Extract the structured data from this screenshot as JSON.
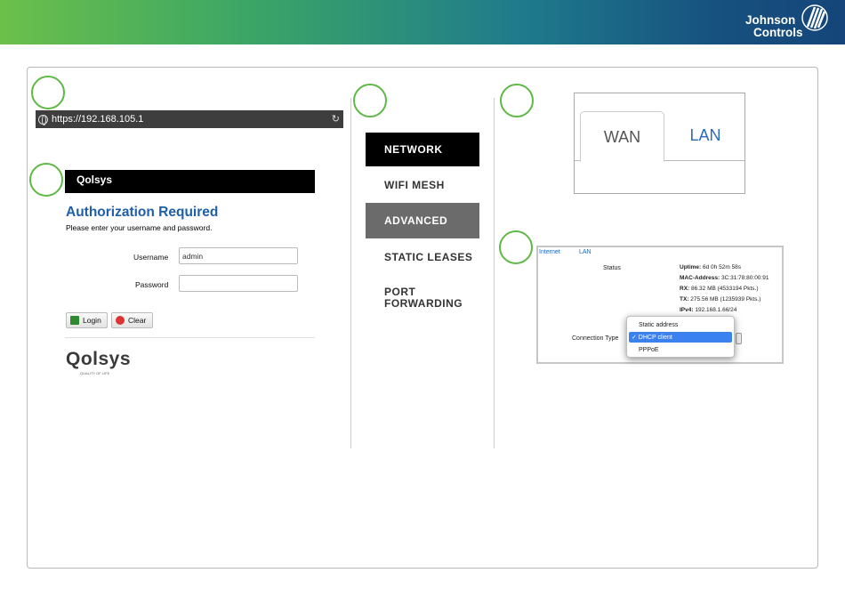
{
  "brand": {
    "line1": "Johnson",
    "line2": "Controls"
  },
  "browser": {
    "url": "https://192.168.105.1"
  },
  "login": {
    "header_logo": "Qolsys",
    "title": "Authorization Required",
    "subtitle": "Please enter your username and password.",
    "username_label": "Username",
    "username_value": "admin",
    "password_label": "Password",
    "login_label": "Login",
    "clear_label": "Clear",
    "footer_logo": "Qolsys",
    "footer_tagline": "QUALITY OF LIFE"
  },
  "menu": {
    "items": [
      {
        "label": "NETWORK",
        "style": "dark"
      },
      {
        "label": "WIFI MESH",
        "style": "plain"
      },
      {
        "label": "ADVANCED",
        "style": "grey"
      },
      {
        "label": "STATIC LEASES",
        "style": "plain"
      },
      {
        "label": "PORT FORWARDING",
        "style": "plain"
      }
    ]
  },
  "tabs": {
    "wan": "WAN",
    "lan": "LAN"
  },
  "network": {
    "tab_internet": "Internet",
    "tab_lan": "LAN",
    "status_label": "Status",
    "uptime_key": "Uptime:",
    "uptime": "6d 0h 52m 58s",
    "mac_key": "MAC-Address:",
    "mac": "3C:31:78:80:00:91",
    "rx_key": "RX:",
    "rx": "86.32 MB (4533194 Pkts.)",
    "tx_key": "TX:",
    "tx": "275.56 MB (1235939 Pkts.)",
    "ipv4_key": "IPv4:",
    "ipv4": "192.168.1.66/24",
    "connection_type_label": "Connection Type",
    "options": [
      "Static address",
      "✓ DHCP client",
      "PPPoE"
    ],
    "selected": "✓ DHCP client"
  },
  "colors": {
    "accent_green": "#5fb946",
    "link_blue": "#1f5fa8",
    "select_blue": "#3b82f0"
  }
}
